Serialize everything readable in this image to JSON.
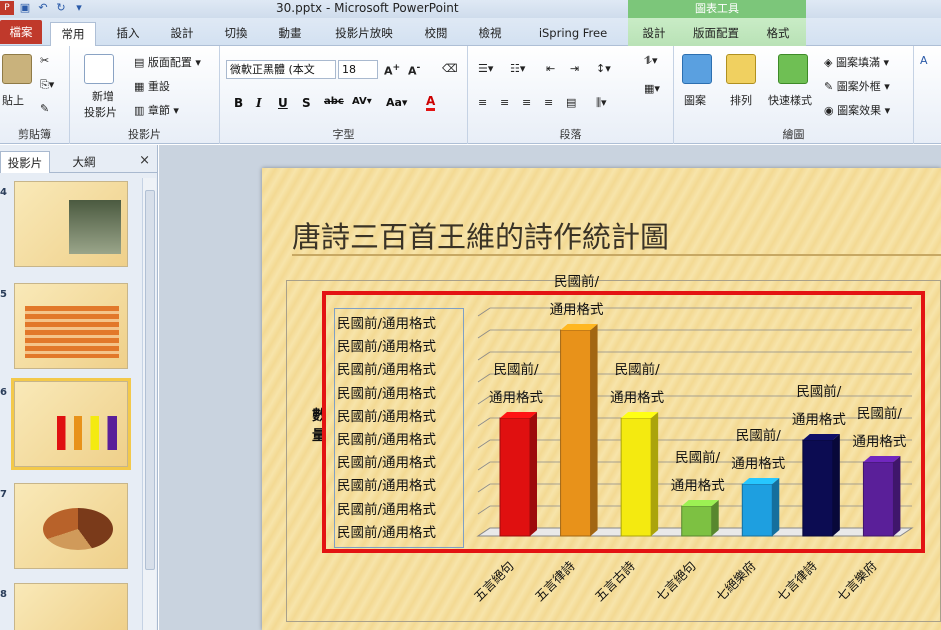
{
  "window": {
    "title": "30.pptx - Microsoft PowerPoint",
    "context_title": "圖表工具"
  },
  "tabs": [
    "檔案",
    "常用",
    "插入",
    "設計",
    "切換",
    "動畫",
    "投影片放映",
    "校閱",
    "檢視",
    "iSpring Free",
    "設計",
    "版面配置",
    "格式"
  ],
  "ribbon": {
    "clipboard": {
      "paste": "貼上",
      "label": "剪貼簿"
    },
    "slides": {
      "new_slide_line1": "新增",
      "new_slide_line2": "投影片",
      "layout": "版面配置",
      "reset": "重設",
      "section": "章節",
      "label": "投影片"
    },
    "font": {
      "font_name": "微軟正黑體 (本文",
      "font_size": "18",
      "label": "字型"
    },
    "paragraph": {
      "label": "段落"
    },
    "drawing": {
      "shapes": "圖案",
      "arrange": "排列",
      "quick_styles": "快速樣式",
      "fill": "圖案填滿",
      "outline": "圖案外框",
      "effects": "圖案效果",
      "label": "繪圖"
    }
  },
  "left_pane": {
    "tab_slides": "投影片",
    "tab_outline": "大綱",
    "close": "×",
    "slide_numbers": [
      "4",
      "5",
      "6",
      "7",
      "8"
    ]
  },
  "slide": {
    "title": "唐詩三百首王維的詩作統計圖",
    "y_axis_title": "數量"
  },
  "colors": {
    "accent_file": "#c0392b",
    "selection_red": "#e31313",
    "context_green": "#7cc67a"
  },
  "chart_data": {
    "type": "bar",
    "title": "唐詩三百首王維的詩作統計圖",
    "ylabel": "數量",
    "categories": [
      "五言絕句",
      "五言律詩",
      "五言古詩",
      "七言絕句",
      "七絕樂府",
      "七言律詩",
      "七言樂府"
    ],
    "values": [
      5,
      9,
      5,
      1,
      2,
      4,
      3
    ],
    "ylim": [
      0,
      10
    ],
    "colors": [
      "#e01010",
      "#e8921a",
      "#f4ea10",
      "#7dc142",
      "#1e9fe0",
      "#0c0c52",
      "#5a1f99"
    ],
    "data_labels": [
      "民國前/通用格式",
      "民國前/通用格式",
      "民國前/通用格式",
      "民國前/通用格式",
      "民國前/通用格式",
      "民國前/通用格式",
      "民國前/通用格式"
    ],
    "tick_labels": [
      "民國前/通用格式",
      "民國前/通用格式",
      "民國前/通用格式",
      "民國前/通用格式",
      "民國前/通用格式",
      "民國前/通用格式",
      "民國前/通用格式",
      "民國前/通用格式",
      "民國前/通用格式",
      "民國前/通用格式"
    ],
    "grid": true,
    "legend": "none"
  }
}
